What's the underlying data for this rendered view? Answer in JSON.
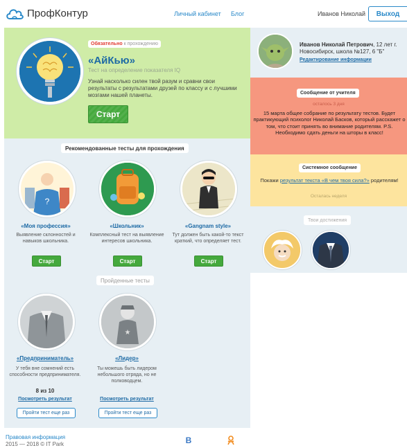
{
  "header": {
    "logo_text": "ПрофКонтур",
    "nav": {
      "cabinet": "Личный кабинет",
      "blog": "Блог"
    },
    "user_name": "Иванов Николай",
    "logout": "Выход"
  },
  "featured": {
    "badge_strong": "Обязательно",
    "badge_rest": " к прохождению",
    "title": "«АйКью»",
    "subtitle": "Тест на определение показателя IQ",
    "description": "Узнай насколько силен твой разум и сравни свои результаты с результатами друзей по классу и с лучшими мозгами нашей планеты.",
    "start": "Старт"
  },
  "recommended": {
    "label": "Рекомендованные тесты для прохождения",
    "items": [
      {
        "title": "«Моя профессия»",
        "desc": "Выявление склонностей и навыков школьника.",
        "start": "Старт"
      },
      {
        "title": "«Школьник»",
        "desc": "Комплексный тест на выявление интересов школьника.",
        "start": "Старт"
      },
      {
        "title": "«Gangnam style»",
        "desc": "Тут должен быть какой-то текст краткий, что определяет тест.",
        "start": "Старт"
      }
    ]
  },
  "completed": {
    "label": "Пройденные тесты",
    "items": [
      {
        "title": "«Предприниматель»",
        "desc": "У тебя вне сомнений есть способности предпринимателя.",
        "score": "8 из 10",
        "result": "Посмотреть результат",
        "retry": "Пройти тест еще раз"
      },
      {
        "title": "«Лидер»",
        "desc": "Ты можешь быть лидером небольшого отряда, но не полководцем.",
        "result": "Посмотреть результат",
        "retry": "Пройти тест еще раз"
      }
    ]
  },
  "profile": {
    "name": "Иванов Николай Петрович",
    "info": ", 12 лет г. Новосибирск, школа №127, 6 \"Б\"",
    "edit": "Редактирование информации"
  },
  "teacher": {
    "label": "Сообщение от учителя",
    "time": "осталось 3 дня",
    "message": "15 марта общее собрание по результату тестов. Будет практикующий психолог Николай Басков, который расскажет о том, что стоит принять во внимание родителям. P.S. Необходимо сдать деньги на шторы в класс!"
  },
  "system": {
    "label": "Системное сообщение",
    "msg_before": "Покажи ",
    "msg_link": "результат текста «В чем твоя сила?»",
    "msg_after": " родителям!",
    "time": "Осталась неделя"
  },
  "achievements": {
    "label": "Твои достижения"
  },
  "footer": {
    "legal": "Правовая информация",
    "copyright": "2015 — 2018 © IT Park",
    "vk": "В",
    "ok": "Ok"
  },
  "colors": {
    "accent": "#2a89c9",
    "green": "#45a93d",
    "featured_bg": "#cfeca7",
    "teacher_bg": "#f6977f",
    "system_bg": "#fde49e",
    "panel_bg": "#e7eff4"
  }
}
